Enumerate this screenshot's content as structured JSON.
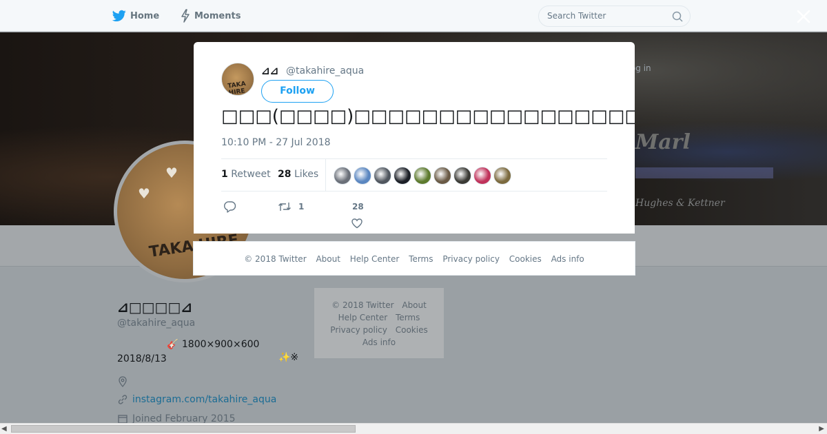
{
  "nav": {
    "home_label": "Home",
    "moments_label": "Moments",
    "search_placeholder": "Search Twitter"
  },
  "banner": {
    "hint": "Have an account? Log in",
    "brand": "Marl",
    "brand2": "Hughes & Kettner"
  },
  "profile": {
    "name": "⊿□□□□⊿",
    "handle": "@takahire_aqua",
    "bio_line1": "🎸 1800×900×600",
    "bio_line2": "2018/8/13",
    "bio_stars": "✨※",
    "link": "instagram.com/takahire_aqua",
    "joined": "Joined February 2015",
    "avatar_text": "TAKA HIRE"
  },
  "background_footer": {
    "items": [
      "© 2018 Twitter",
      "About",
      "Help Center",
      "Terms",
      "Privacy policy",
      "Cookies",
      "Ads info"
    ]
  },
  "tweet": {
    "name": "⊿⊿",
    "handle": "@takahire_aqua",
    "follow_label": "Follow",
    "text": "□□□(□□□□)□□□□□□□□□□□□□□□□□□□□□□□□□□□□□□□□□□□□□□□□□□□□□□□",
    "time": "10:10 PM - 27 Jul 2018",
    "retweet_count": "1",
    "retweet_label": "Retweet",
    "like_count": "28",
    "like_label": "Likes",
    "action_retweets": "1",
    "action_likes": "28",
    "avatar_text": "TAKA HIRE"
  },
  "likers": [
    {
      "color": "#6a6f78"
    },
    {
      "color": "#5a86c0"
    },
    {
      "color": "#50565e"
    },
    {
      "color": "#1c1f26"
    },
    {
      "color": "#5d7a2d"
    },
    {
      "color": "#6a5a45"
    },
    {
      "color": "#3b3a35"
    },
    {
      "color": "#c0325a"
    },
    {
      "color": "#7c6a3e"
    }
  ],
  "modal_footer": {
    "items": [
      "© 2018 Twitter",
      "About",
      "Help Center",
      "Terms",
      "Privacy policy",
      "Cookies",
      "Ads info"
    ]
  },
  "colors": {
    "accent": "#1da1f2",
    "link": "#1b6c94"
  }
}
